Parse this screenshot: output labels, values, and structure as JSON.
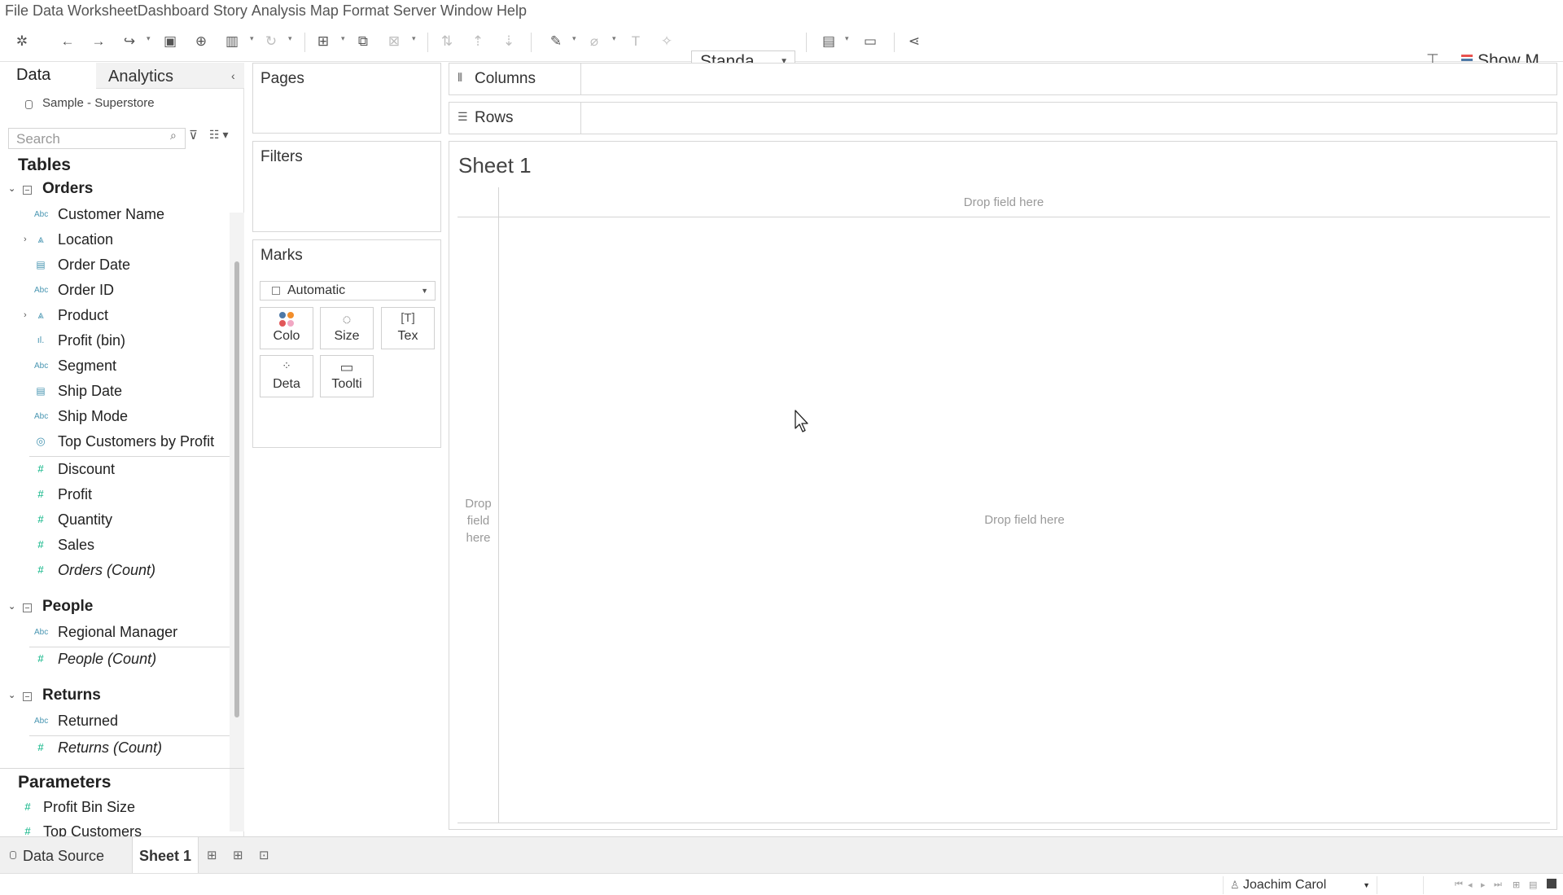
{
  "menu": [
    "File",
    "Data",
    "Worksheet",
    "Dashboard",
    "Story",
    "Analysis",
    "Map",
    "Format",
    "Server",
    "Window",
    "Help"
  ],
  "toolbar": {
    "fit_dropdown": "Standa...",
    "show_me": "Show M"
  },
  "left_panel": {
    "tab_data": "Data",
    "tab_analytics": "Analytics",
    "datasource": "Sample - Superstore",
    "search_placeholder": "Search",
    "tables_title": "Tables",
    "tables": [
      {
        "name": "Orders",
        "dimensions": [
          {
            "label": "Customer Name",
            "type": "Abc"
          },
          {
            "label": "Location",
            "type": "hierarchy"
          },
          {
            "label": "Order Date",
            "type": "date"
          },
          {
            "label": "Order ID",
            "type": "Abc"
          },
          {
            "label": "Product",
            "type": "hierarchy"
          },
          {
            "label": "Profit (bin)",
            "type": "bin"
          },
          {
            "label": "Segment",
            "type": "Abc"
          },
          {
            "label": "Ship Date",
            "type": "date"
          },
          {
            "label": "Ship Mode",
            "type": "Abc"
          },
          {
            "label": "Top Customers by Profit",
            "type": "set"
          }
        ],
        "measures": [
          {
            "label": "Discount"
          },
          {
            "label": "Profit"
          },
          {
            "label": "Quantity"
          },
          {
            "label": "Sales"
          },
          {
            "label": "Orders (Count)"
          }
        ]
      },
      {
        "name": "People",
        "dimensions": [
          {
            "label": "Regional Manager",
            "type": "Abc"
          }
        ],
        "measures": [
          {
            "label": "People (Count)"
          }
        ]
      },
      {
        "name": "Returns",
        "dimensions": [
          {
            "label": "Returned",
            "type": "Abc"
          }
        ],
        "measures": [
          {
            "label": "Returns (Count)"
          }
        ]
      }
    ],
    "parameters_title": "Parameters",
    "parameters": [
      "Profit Bin Size",
      "Top Customers"
    ]
  },
  "cards": {
    "pages": "Pages",
    "filters": "Filters",
    "marks": "Marks",
    "mark_type": "Automatic",
    "mark_buttons": [
      "Colo",
      "Size",
      "Tex",
      "Deta",
      "Toolti"
    ]
  },
  "shelves": {
    "columns": "Columns",
    "rows": "Rows"
  },
  "view": {
    "sheet_title": "Sheet 1",
    "drop_top": "Drop field here",
    "drop_left": "Drop\nfield\nhere",
    "drop_center": "Drop field here"
  },
  "bottom_tabs": {
    "data_source": "Data Source",
    "sheet": "Sheet 1"
  },
  "status": {
    "user": "Joachim Carol"
  },
  "colors": {
    "dimension_icon": "#4996b2",
    "measure_icon": "#00b180"
  }
}
